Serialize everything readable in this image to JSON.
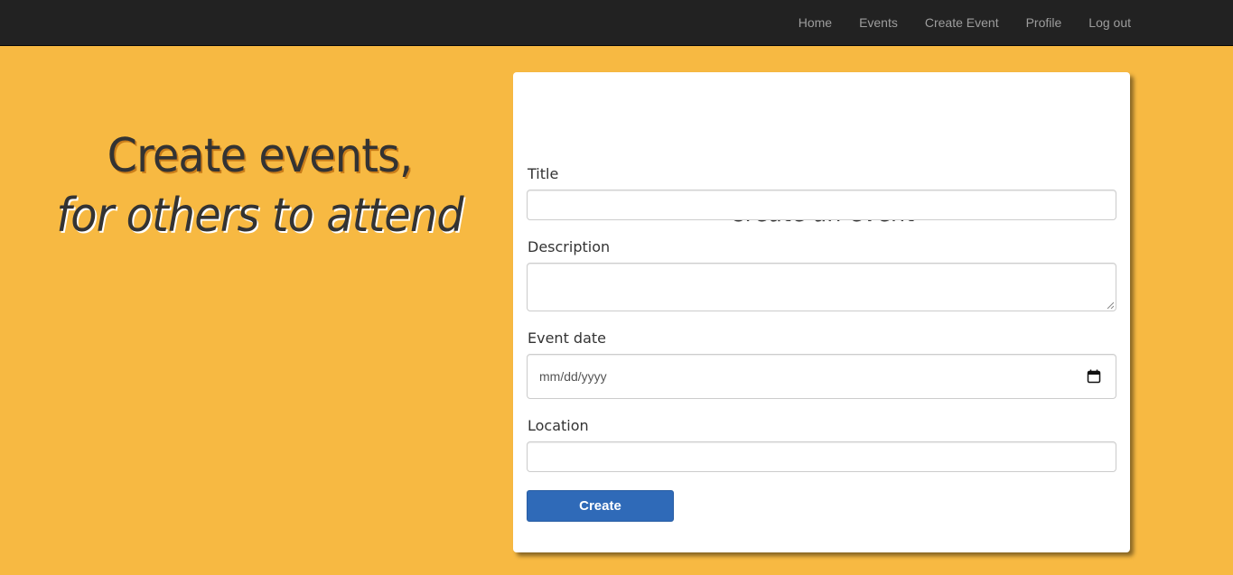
{
  "nav": {
    "links": [
      "Home",
      "Events",
      "Create Event",
      "Profile",
      "Log out"
    ]
  },
  "hero": {
    "line1": "Create events,",
    "line2": "for others to attend"
  },
  "form": {
    "title": "Create an event",
    "fields": {
      "title_label": "Title",
      "description_label": "Description",
      "event_date_label": "Event date",
      "event_date_placeholder": "mm/dd/yyyy",
      "location_label": "Location"
    },
    "submit_label": "Create"
  },
  "colors": {
    "background": "#f7b942",
    "navbar": "#222222",
    "button": "#2f6ab8"
  }
}
